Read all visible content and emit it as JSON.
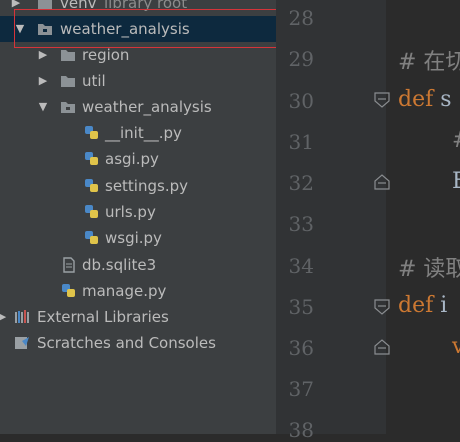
{
  "tree": {
    "items": [
      {
        "label": "venv",
        "label2": "library root"
      },
      {
        "label": "weather_analysis"
      },
      {
        "label": "region"
      },
      {
        "label": "util"
      },
      {
        "label": "weather_analysis"
      },
      {
        "label": "__init__.py"
      },
      {
        "label": "asgi.py"
      },
      {
        "label": "settings.py"
      },
      {
        "label": "urls.py"
      },
      {
        "label": "wsgi.py"
      },
      {
        "label": "db.sqlite3"
      },
      {
        "label": "manage.py"
      },
      {
        "label": "External Libraries"
      },
      {
        "label": "Scratches and Consoles"
      }
    ]
  },
  "editor": {
    "line_numbers": [
      "28",
      "29",
      "30",
      "31",
      "32",
      "33",
      "34",
      "35",
      "36",
      "37",
      "38"
    ],
    "lines": [
      {
        "num": "28",
        "text": ""
      },
      {
        "num": "29",
        "text": "# 在切"
      },
      {
        "num": "30",
        "kw": "def",
        "text": "s"
      },
      {
        "num": "31",
        "text": "#"
      },
      {
        "num": "32",
        "text": "E"
      },
      {
        "num": "33",
        "text": ""
      },
      {
        "num": "34",
        "text": "# 读取"
      },
      {
        "num": "35",
        "kw": "def",
        "text": "i"
      },
      {
        "num": "36",
        "text": "v"
      },
      {
        "num": "37",
        "text": ""
      },
      {
        "num": "38",
        "text": ""
      }
    ]
  },
  "colors": {
    "selection": "#0d293e",
    "highlight_box": "#d5343a",
    "keyword": "#cc7832",
    "comment": "#808080",
    "text": "#a9b7c6"
  }
}
